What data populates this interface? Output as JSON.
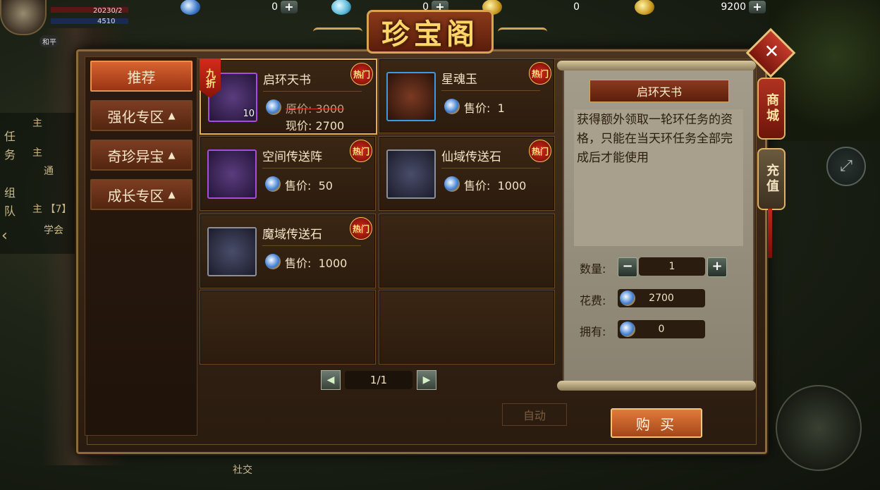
{
  "hud": {
    "player_level_text": "20230/2",
    "player_sub_text": "4510",
    "peace_mode_label": "和平",
    "bottom_label": "社交",
    "auto_label": "自动",
    "side_quest_labels": [
      "任",
      "务",
      "组",
      "队"
    ],
    "quest_lines": [
      "主",
      "主",
      "通",
      "主 【7】",
      "学会"
    ]
  },
  "resources": [
    {
      "icon": "silver-coin-icon",
      "value": "0"
    },
    {
      "icon": "jade-icon",
      "value": "0"
    },
    {
      "icon": "gold-coin-icon",
      "value": "0"
    },
    {
      "icon": "ingot-icon",
      "value": "9200"
    }
  ],
  "shop": {
    "title": "珍宝阁",
    "side_tabs": {
      "shop": "商城",
      "recharge": "充值"
    },
    "categories": [
      {
        "label": "推荐",
        "active": true,
        "arrow": ""
      },
      {
        "label": "强化专区",
        "active": false,
        "arrow": "▲"
      },
      {
        "label": "奇珍异宝",
        "active": false,
        "arrow": "▲"
      },
      {
        "label": "成长专区",
        "active": false,
        "arrow": "▲"
      }
    ],
    "items": [
      {
        "name": "启环天书",
        "badge": "热门",
        "discount": "九折",
        "count": "10",
        "orig_label": "原价:",
        "orig_price": "3000",
        "price_label": "现价:",
        "price": "2700",
        "frame": "purple",
        "selected": true
      },
      {
        "name": "星魂玉",
        "badge": "热门",
        "price_label": "售价:",
        "price": "1",
        "frame": "blue"
      },
      {
        "name": "空间传送阵",
        "badge": "热门",
        "price_label": "售价:",
        "price": "50",
        "frame": "purple"
      },
      {
        "name": "仙域传送石",
        "badge": "热门",
        "price_label": "售价:",
        "price": "1000",
        "frame": "gray"
      },
      {
        "name": "魔域传送石",
        "badge": "热门",
        "price_label": "售价:",
        "price": "1000",
        "frame": "gray"
      }
    ],
    "pagination": {
      "prev": "◀",
      "text": "1/1",
      "next": "▶"
    },
    "detail": {
      "title": "启环天书",
      "description": "获得额外领取一轮环任务的资格，只能在当天环任务全部完成后才能使用",
      "quantity_label": "数量:",
      "quantity": "1",
      "minus": "−",
      "plus": "+",
      "cost_label": "花费:",
      "cost": "2700",
      "owned_label": "拥有:",
      "owned": "0"
    },
    "buy_label": "购 买",
    "close_symbol": "✕"
  }
}
